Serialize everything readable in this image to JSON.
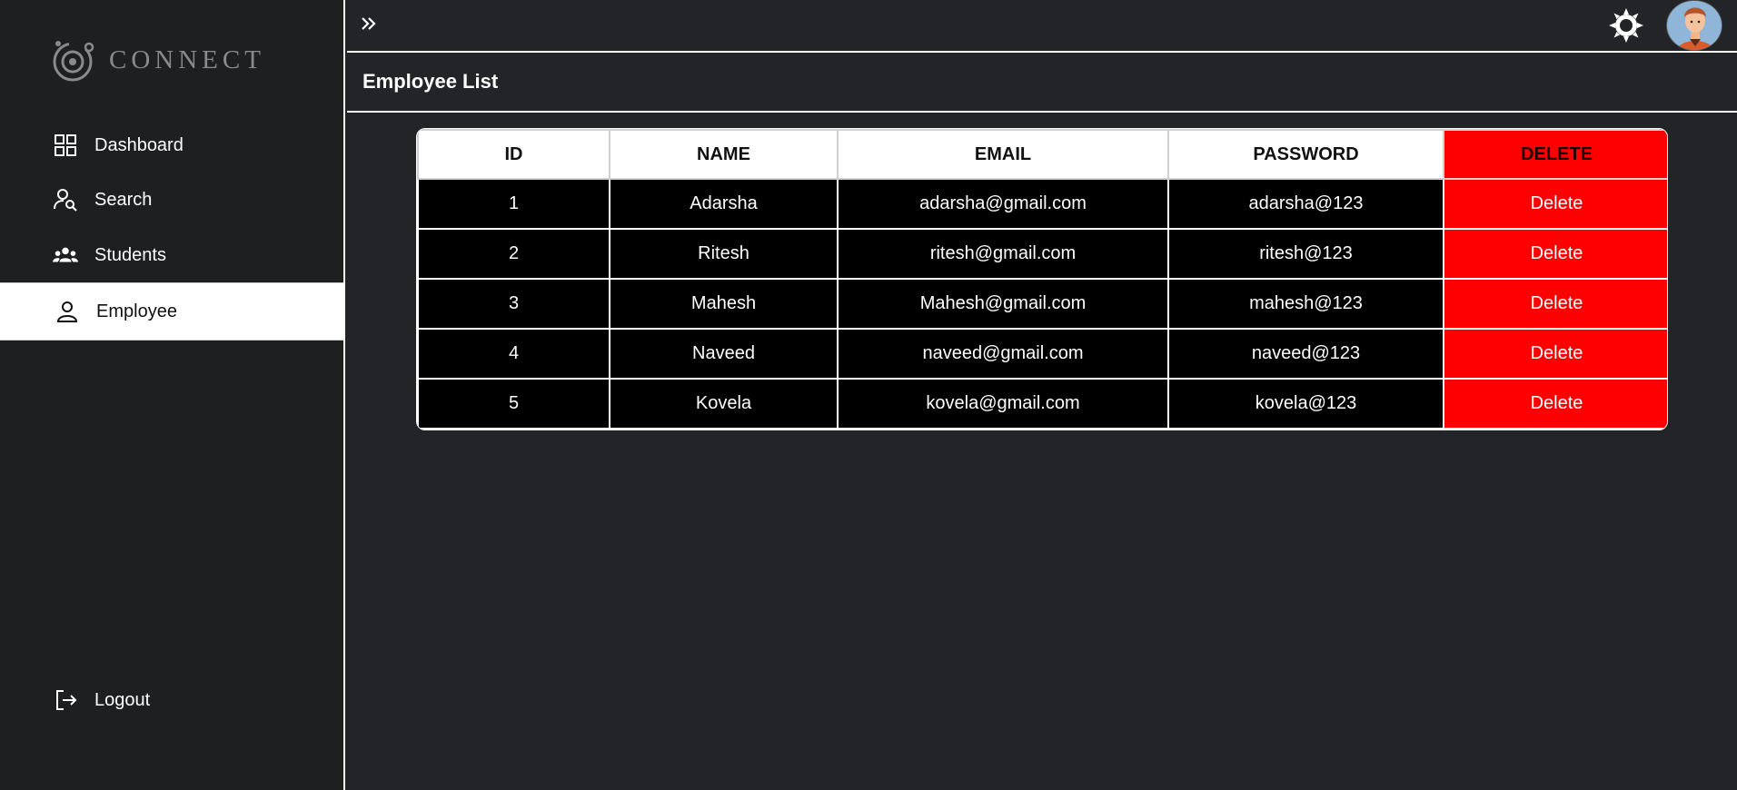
{
  "sidebar": {
    "logo_text": "CONNECT",
    "items": [
      {
        "label": "Dashboard",
        "icon": "grid-icon"
      },
      {
        "label": "Search",
        "icon": "user-search-icon"
      },
      {
        "label": "Students",
        "icon": "users-icon"
      },
      {
        "label": "Employee",
        "icon": "user-icon",
        "active": true
      }
    ],
    "logout_label": "Logout"
  },
  "topbar": {
    "expand_icon": "double-chevron-right-icon",
    "theme_icon": "sun-icon",
    "avatar": "avatar"
  },
  "page": {
    "title": "Employee List"
  },
  "table": {
    "headers": [
      "ID",
      "NAME",
      "EMAIL",
      "PASSWORD",
      "DELETE"
    ],
    "rows": [
      {
        "id": "1",
        "name": "Adarsha",
        "email": "adarsha@gmail.com",
        "password": "adarsha@123",
        "action": "Delete"
      },
      {
        "id": "2",
        "name": "Ritesh",
        "email": "ritesh@gmail.com",
        "password": "ritesh@123",
        "action": "Delete"
      },
      {
        "id": "3",
        "name": "Mahesh",
        "email": "Mahesh@gmail.com",
        "password": "mahesh@123",
        "action": "Delete"
      },
      {
        "id": "4",
        "name": "Naveed",
        "email": "naveed@gmail.com",
        "password": "naveed@123",
        "action": "Delete"
      },
      {
        "id": "5",
        "name": "Kovela",
        "email": "kovela@gmail.com",
        "password": "kovela@123",
        "action": "Delete"
      }
    ]
  },
  "colors": {
    "background": "#232427",
    "sidebar": "#1e1f21",
    "danger": "#ff0000",
    "row": "#000000"
  }
}
